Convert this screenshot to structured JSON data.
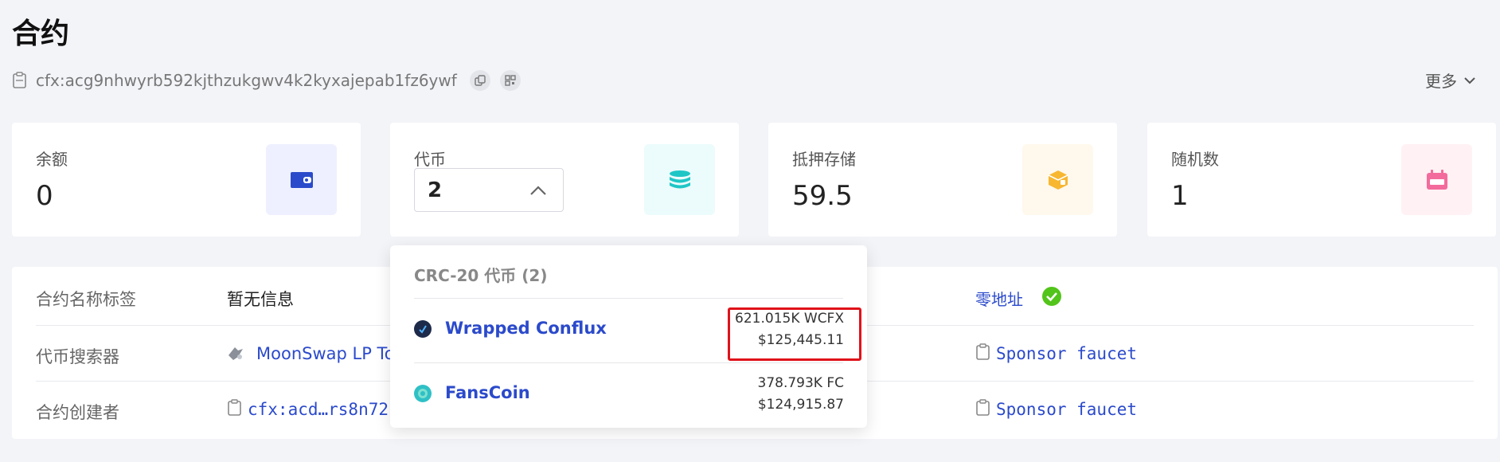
{
  "page": {
    "title": "合约",
    "address": "cfx:acg9nhwyrb592kjthzukgwv4k2kyxajepab1fz6ywf",
    "more_label": "更多"
  },
  "cards": {
    "balance": {
      "label": "余额",
      "value": "0",
      "icon": "wallet-icon",
      "icon_bg": "#eef0ff",
      "icon_color": "#2b4acb"
    },
    "tokens": {
      "label": "代币",
      "selected": "2",
      "icon": "coins-stack-icon",
      "icon_bg": "#ecfbfb",
      "icon_color": "#1fc6c6"
    },
    "storage": {
      "label": "抵押存储",
      "value": "59.5",
      "icon": "storage-box-icon",
      "icon_bg": "#fff8ec",
      "icon_color": "#f7b731"
    },
    "nonce": {
      "label": "随机数",
      "value": "1",
      "icon": "calendar-icon",
      "icon_bg": "#fff1f4",
      "icon_color": "#f36b9c"
    }
  },
  "info": {
    "rows": [
      {
        "label": "合约名称标签",
        "value": "暂无信息"
      },
      {
        "label": "代币搜索器",
        "value": "MoonSwap LP Tok"
      },
      {
        "label": "合约创建者",
        "value": "cfx:acd…rs8n72"
      }
    ],
    "right": [
      {
        "value": "零地址"
      },
      {
        "value": "Sponsor faucet"
      },
      {
        "value": "Sponsor faucet"
      }
    ]
  },
  "dropdown": {
    "header": "CRC-20 代币 (2)",
    "tokens": [
      {
        "name": "Wrapped Conflux",
        "amount": "621.015K WCFX",
        "usd": "$125,445.11",
        "icon_color": "#1e2a4a"
      },
      {
        "name": "FansCoin",
        "amount": "378.793K FC",
        "usd": "$124,915.87",
        "icon_color": "#2fc0c6"
      }
    ]
  },
  "colors": {
    "accent": "#2b4acb",
    "highlight": "#e0121a",
    "success": "#52c41a"
  }
}
